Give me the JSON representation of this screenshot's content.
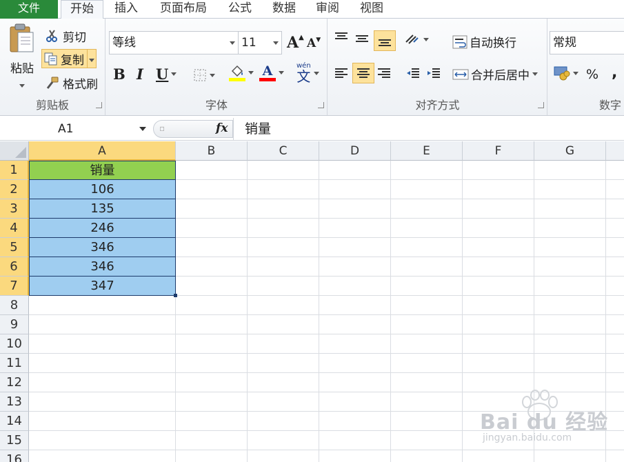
{
  "tabs": [
    {
      "label": "文件"
    },
    {
      "label": "开始"
    },
    {
      "label": "插入"
    },
    {
      "label": "页面布局"
    },
    {
      "label": "公式"
    },
    {
      "label": "数据"
    },
    {
      "label": "审阅"
    },
    {
      "label": "视图"
    }
  ],
  "clipboard": {
    "group": "剪贴板",
    "paste": "粘贴",
    "cut": "剪切",
    "copy": "复制",
    "format_painter": "格式刷"
  },
  "font": {
    "group": "字体",
    "name": "等线",
    "size": "11",
    "bold": "B",
    "italic": "I",
    "underline": "U",
    "font_color_glyph": "A",
    "phonetic_glyph": "wén",
    "phonetic_char": "文",
    "grow": "A",
    "shrink": "A",
    "fill_color": "#ffff00",
    "font_color": "#ff0000"
  },
  "alignment": {
    "group": "对齐方式",
    "wrap": "自动换行",
    "merge": "合并后居中"
  },
  "number": {
    "group": "数字",
    "format": "常规",
    "percent": "%",
    "comma": ","
  },
  "formula_bar": {
    "name_box": "A1",
    "fx": "fx",
    "content": "销量"
  },
  "sheet": {
    "columns": [
      "A",
      "B",
      "C",
      "D",
      "E",
      "F",
      "G"
    ],
    "rows": [
      "1",
      "2",
      "3",
      "4",
      "5",
      "6",
      "7",
      "8",
      "9",
      "10",
      "11",
      "12",
      "13",
      "14",
      "15",
      "16"
    ],
    "header": "销量",
    "values": [
      "106",
      "135",
      "246",
      "346",
      "346",
      "347"
    ],
    "header_fill": "#92d050",
    "value_fill": "#9fcdf0"
  },
  "watermark": {
    "brand": "Bai du 经验",
    "url": "jingyan.baidu.com"
  }
}
